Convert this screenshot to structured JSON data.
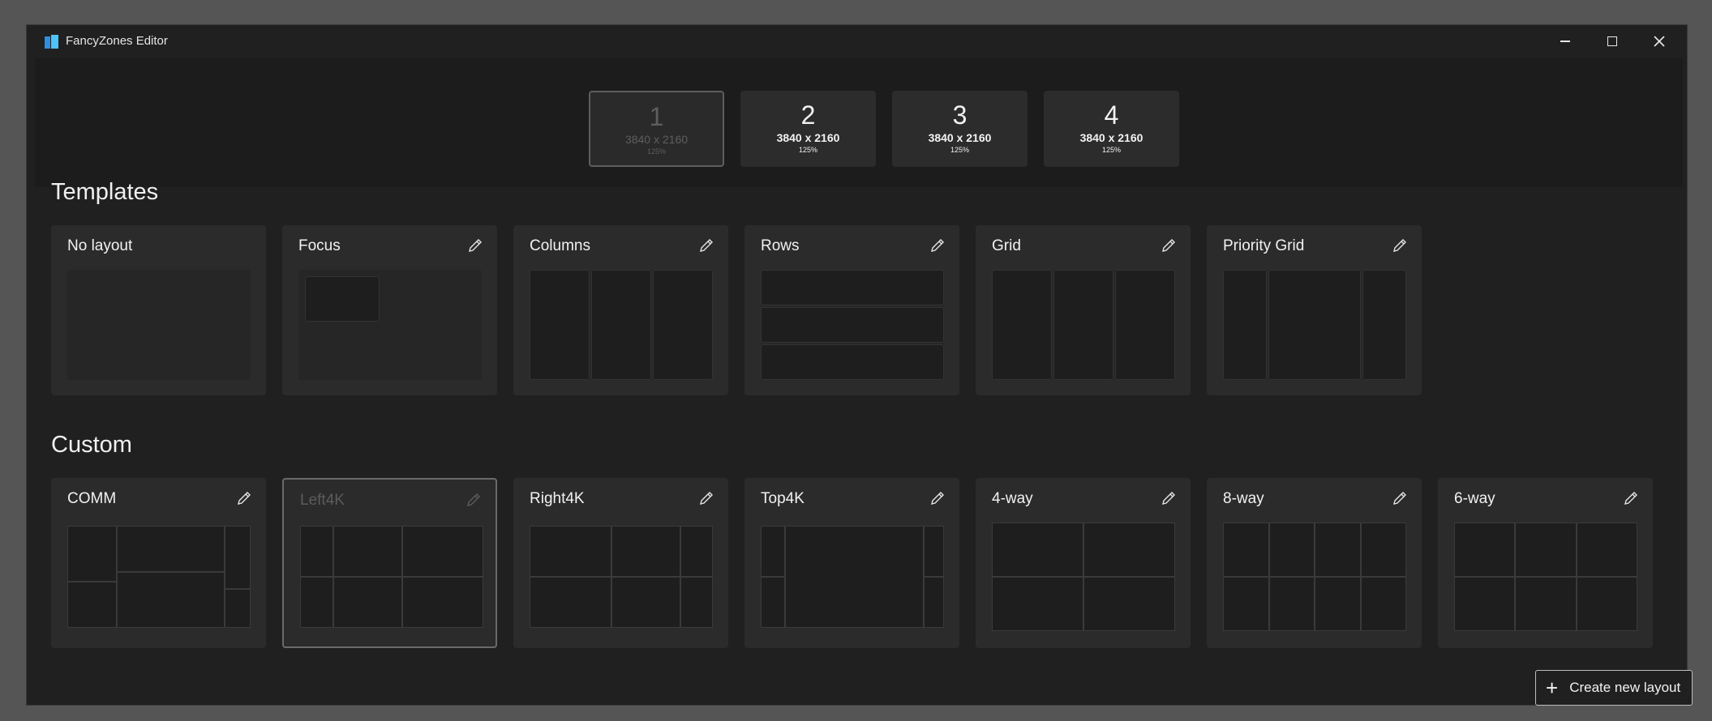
{
  "window": {
    "title": "FancyZones Editor"
  },
  "monitors": [
    {
      "number": "1",
      "resolution": "3840 x 2160",
      "scale": "125%"
    },
    {
      "number": "2",
      "resolution": "3840 x 2160",
      "scale": "125%"
    },
    {
      "number": "3",
      "resolution": "3840 x 2160",
      "scale": "125%"
    },
    {
      "number": "4",
      "resolution": "3840 x 2160",
      "scale": "125%"
    }
  ],
  "templates": {
    "title": "Templates",
    "items": [
      {
        "name": "No layout"
      },
      {
        "name": "Focus"
      },
      {
        "name": "Columns"
      },
      {
        "name": "Rows"
      },
      {
        "name": "Grid"
      },
      {
        "name": "Priority Grid"
      }
    ]
  },
  "custom": {
    "title": "Custom",
    "items": [
      {
        "name": "COMM"
      },
      {
        "name": "Left4K"
      },
      {
        "name": "Right4K"
      },
      {
        "name": "Top4K"
      },
      {
        "name": "4-way"
      },
      {
        "name": "8-way"
      },
      {
        "name": "6-way"
      }
    ]
  },
  "create_button": {
    "label": "Create new layout"
  },
  "icons": {
    "edit": "pencil-icon",
    "plus": "plus-icon",
    "minimize": "minimize-icon",
    "maximize": "maximize-icon",
    "close": "close-icon",
    "cursor": "mouse-cursor-icon"
  },
  "colors": {
    "background": "#202020",
    "card": "#2b2b2b",
    "zone": "#1e1e1e",
    "accent_app_icon": "#4fc3f7"
  }
}
